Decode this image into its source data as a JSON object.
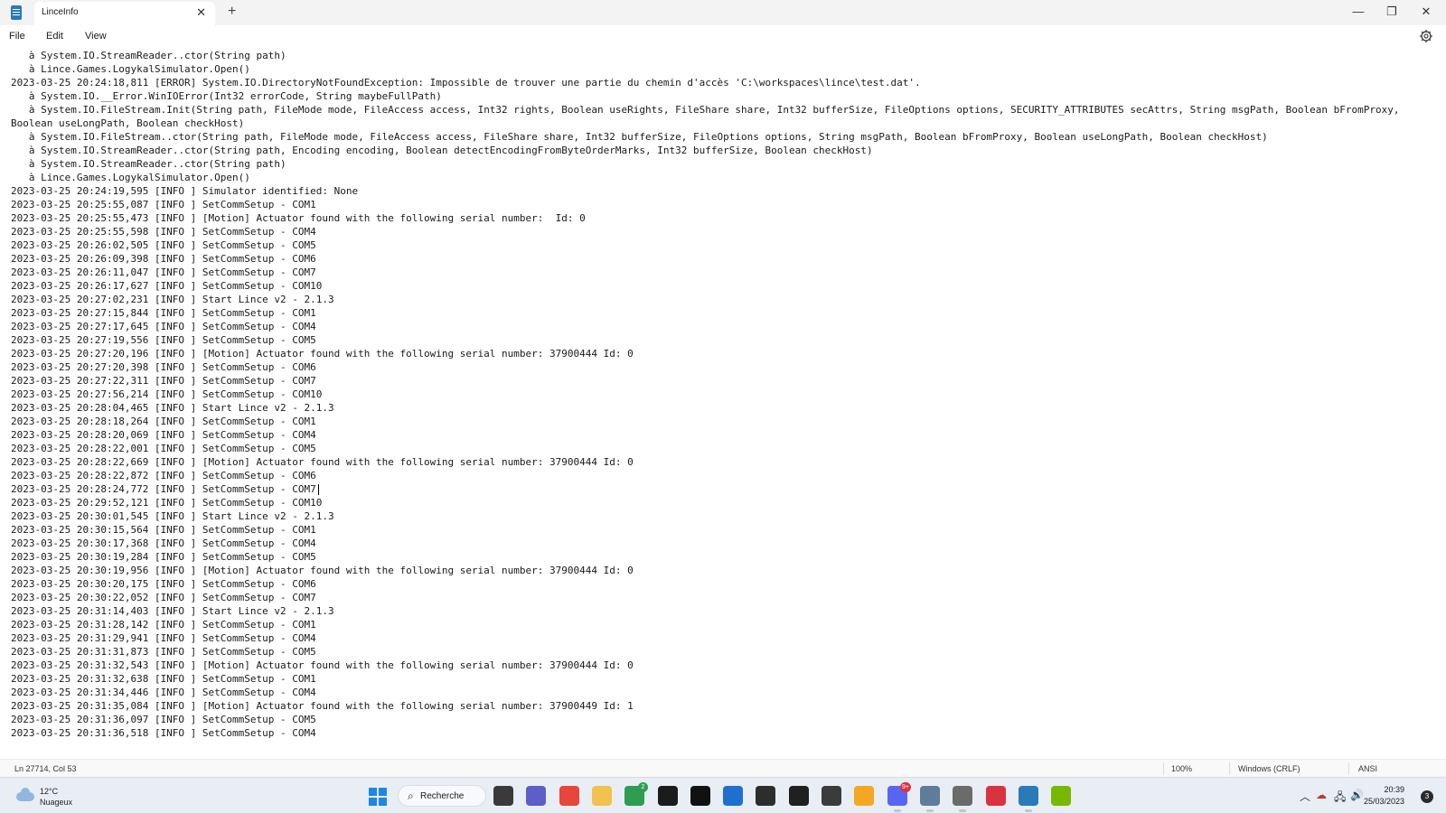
{
  "window": {
    "tab_title": "LinceInfo",
    "tab_close": "✕",
    "new_tab": "+",
    "minimize": "—",
    "maximize": "❐",
    "close": "✕"
  },
  "menu": {
    "file": "File",
    "edit": "Edit",
    "view": "View"
  },
  "editor": {
    "lines": [
      "   à System.IO.StreamReader..ctor(String path)",
      "   à Lince.Games.LogykalSimulator.Open()",
      "2023-03-25 20:24:18,811 [ERROR] System.IO.DirectoryNotFoundException: Impossible de trouver une partie du chemin d'accès 'C:\\workspaces\\lince\\test.dat'.",
      "   à System.IO.__Error.WinIOError(Int32 errorCode, String maybeFullPath)",
      "   à System.IO.FileStream.Init(String path, FileMode mode, FileAccess access, Int32 rights, Boolean useRights, FileShare share, Int32 bufferSize, FileOptions options, SECURITY_ATTRIBUTES secAttrs, String msgPath, Boolean bFromProxy, Boolean useLongPath, Boolean checkHost)",
      "   à System.IO.FileStream..ctor(String path, FileMode mode, FileAccess access, FileShare share, Int32 bufferSize, FileOptions options, String msgPath, Boolean bFromProxy, Boolean useLongPath, Boolean checkHost)",
      "   à System.IO.StreamReader..ctor(String path, Encoding encoding, Boolean detectEncodingFromByteOrderMarks, Int32 bufferSize, Boolean checkHost)",
      "   à System.IO.StreamReader..ctor(String path)",
      "   à Lince.Games.LogykalSimulator.Open()",
      "2023-03-25 20:24:19,595 [INFO ] Simulator identified: None",
      "2023-03-25 20:25:55,087 [INFO ] SetCommSetup - COM1",
      "2023-03-25 20:25:55,473 [INFO ] [Motion] Actuator found with the following serial number:  Id: 0",
      "2023-03-25 20:25:55,598 [INFO ] SetCommSetup - COM4",
      "2023-03-25 20:26:02,505 [INFO ] SetCommSetup - COM5",
      "2023-03-25 20:26:09,398 [INFO ] SetCommSetup - COM6",
      "2023-03-25 20:26:11,047 [INFO ] SetCommSetup - COM7",
      "2023-03-25 20:26:17,627 [INFO ] SetCommSetup - COM10",
      "2023-03-25 20:27:02,231 [INFO ] Start Lince v2 - 2.1.3",
      "2023-03-25 20:27:15,844 [INFO ] SetCommSetup - COM1",
      "2023-03-25 20:27:17,645 [INFO ] SetCommSetup - COM4",
      "2023-03-25 20:27:19,556 [INFO ] SetCommSetup - COM5",
      "2023-03-25 20:27:20,196 [INFO ] [Motion] Actuator found with the following serial number: 37900444 Id: 0",
      "2023-03-25 20:27:20,398 [INFO ] SetCommSetup - COM6",
      "2023-03-25 20:27:22,311 [INFO ] SetCommSetup - COM7",
      "2023-03-25 20:27:56,214 [INFO ] SetCommSetup - COM10",
      "2023-03-25 20:28:04,465 [INFO ] Start Lince v2 - 2.1.3",
      "2023-03-25 20:28:18,264 [INFO ] SetCommSetup - COM1",
      "2023-03-25 20:28:20,069 [INFO ] SetCommSetup - COM4",
      "2023-03-25 20:28:22,001 [INFO ] SetCommSetup - COM5",
      "2023-03-25 20:28:22,669 [INFO ] [Motion] Actuator found with the following serial number: 37900444 Id: 0",
      "2023-03-25 20:28:22,872 [INFO ] SetCommSetup - COM6",
      "2023-03-25 20:28:24,772 [INFO ] SetCommSetup - COM7",
      "2023-03-25 20:29:52,121 [INFO ] SetCommSetup - COM10",
      "2023-03-25 20:30:01,545 [INFO ] Start Lince v2 - 2.1.3",
      "2023-03-25 20:30:15,564 [INFO ] SetCommSetup - COM1",
      "2023-03-25 20:30:17,368 [INFO ] SetCommSetup - COM4",
      "2023-03-25 20:30:19,284 [INFO ] SetCommSetup - COM5",
      "2023-03-25 20:30:19,956 [INFO ] [Motion] Actuator found with the following serial number: 37900444 Id: 0",
      "2023-03-25 20:30:20,175 [INFO ] SetCommSetup - COM6",
      "2023-03-25 20:30:22,052 [INFO ] SetCommSetup - COM7",
      "2023-03-25 20:31:14,403 [INFO ] Start Lince v2 - 2.1.3",
      "2023-03-25 20:31:28,142 [INFO ] SetCommSetup - COM1",
      "2023-03-25 20:31:29,941 [INFO ] SetCommSetup - COM4",
      "2023-03-25 20:31:31,873 [INFO ] SetCommSetup - COM5",
      "2023-03-25 20:31:32,543 [INFO ] [Motion] Actuator found with the following serial number: 37900444 Id: 0",
      "2023-03-25 20:31:32,638 [INFO ] SetCommSetup - COM1",
      "2023-03-25 20:31:34,446 [INFO ] SetCommSetup - COM4",
      "2023-03-25 20:31:35,084 [INFO ] [Motion] Actuator found with the following serial number: 37900449 Id: 1",
      "2023-03-25 20:31:36,097 [INFO ] SetCommSetup - COM5",
      "2023-03-25 20:31:36,518 [INFO ] SetCommSetup - COM4"
    ],
    "caret_line": 31
  },
  "status": {
    "position": "Ln 27714, Col 53",
    "zoom": "100%",
    "line_ending": "Windows (CRLF)",
    "encoding": "ANSI"
  },
  "taskbar": {
    "weather_temp": "12°C",
    "weather_cond": "Nuageux",
    "search_label": "Recherche",
    "search_icon": "⌕",
    "apps": [
      {
        "name": "file-explorer-window-icon",
        "color": "#3a3a3a",
        "badge": ""
      },
      {
        "name": "teams-icon",
        "color": "#5b5fc7",
        "badge": ""
      },
      {
        "name": "chrome-icon",
        "color": "#e8453c",
        "badge": ""
      },
      {
        "name": "folder-icon",
        "color": "#f2c14e",
        "badge": ""
      },
      {
        "name": "xbox-icon",
        "color": "#2e9d52",
        "badge": "2"
      },
      {
        "name": "steam-like-icon",
        "color": "#1b1b1b",
        "badge": ""
      },
      {
        "name": "nvidia-icon",
        "color": "#111111",
        "badge": ""
      },
      {
        "name": "store-icon",
        "color": "#1f6fd1",
        "badge": ""
      },
      {
        "name": "game-icon",
        "color": "#2d2d2d",
        "badge": ""
      },
      {
        "name": "media-icon",
        "color": "#202020",
        "badge": ""
      },
      {
        "name": "unity-icon",
        "color": "#3b3b3b",
        "badge": ""
      },
      {
        "name": "weather-sun-icon",
        "color": "#f5a623",
        "badge": ""
      },
      {
        "name": "discord-icon",
        "color": "#5865f2",
        "badge": "9+"
      },
      {
        "name": "monitor-chart-icon",
        "color": "#5f7c9a",
        "badge": ""
      },
      {
        "name": "tools-icon",
        "color": "#6b6b6b",
        "badge": ""
      },
      {
        "name": "antivirus-icon",
        "color": "#d9333f",
        "badge": ""
      },
      {
        "name": "notepad-icon",
        "color": "#2a7ab8",
        "badge": ""
      },
      {
        "name": "nvidia-green-icon",
        "color": "#76b900",
        "badge": ""
      }
    ],
    "tray": {
      "chevron": "︿",
      "network": "🖧",
      "volume": "🔊",
      "time": "20:39",
      "date": "25/03/2023",
      "notifications": "3"
    }
  }
}
